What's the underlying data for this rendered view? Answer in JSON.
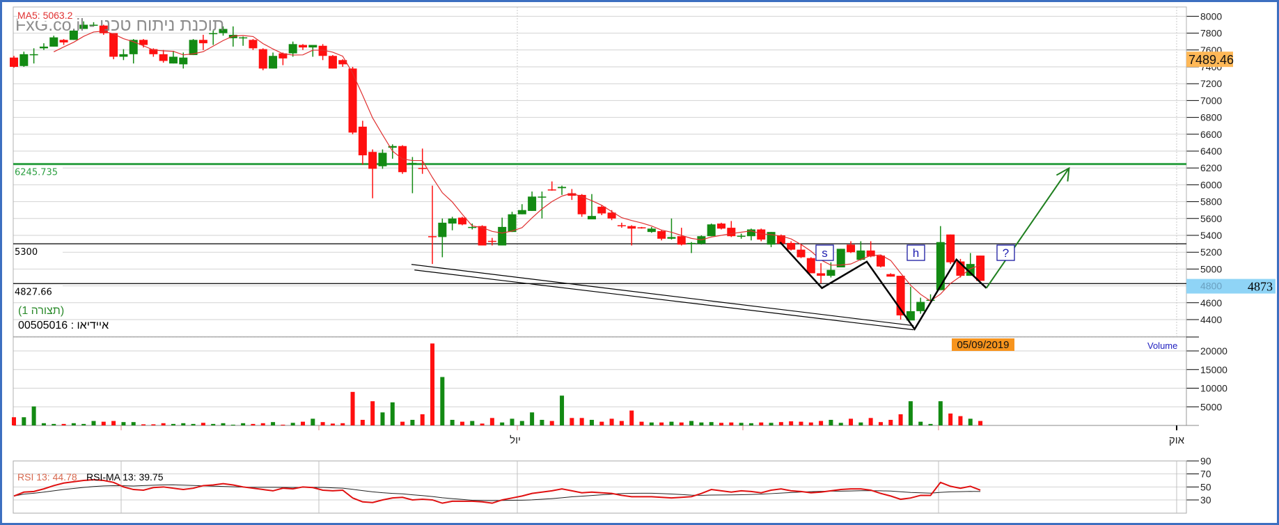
{
  "watermark": "FxG.co.il - תוכנת ניתוח טכני",
  "chart_data": {
    "type": "candlestick",
    "price_axis": {
      "ticks": [
        8000,
        7800,
        7600,
        7400,
        7200,
        7000,
        6800,
        6600,
        6400,
        6200,
        6000,
        5800,
        5600,
        5400,
        5200,
        5000,
        4800,
        4600,
        4400
      ],
      "tick_labels": [
        "8000",
        "7800",
        "7600",
        "7400",
        "7200",
        "7000",
        "6800",
        "6600",
        "6400",
        "6200",
        "6000",
        "5800",
        "5600",
        "5400",
        "5200",
        "5000",
        "4800",
        "4600",
        "4400"
      ],
      "ylim": [
        4200,
        8100
      ],
      "grid": true
    },
    "x_axis": {
      "tick_labels": [
        "יול",
        "אוק"
      ]
    },
    "ma": {
      "label": "MA5:  5063.2",
      "period": 5,
      "color": "#e03030"
    },
    "up_color": "#138a13",
    "down_color": "#ff1010",
    "ohlc": [
      [
        7510,
        7530,
        7390,
        7400
      ],
      [
        7410,
        7580,
        7400,
        7550
      ],
      [
        7550,
        7620,
        7440,
        7550
      ],
      [
        7620,
        7680,
        7600,
        7640
      ],
      [
        7640,
        7770,
        7640,
        7750
      ],
      [
        7720,
        7730,
        7660,
        7690
      ],
      [
        7720,
        7850,
        7720,
        7830
      ],
      [
        7850,
        7940,
        7850,
        7900
      ],
      [
        7900,
        7930,
        7880,
        7900
      ],
      [
        7890,
        7900,
        7780,
        7800
      ],
      [
        7800,
        7800,
        7490,
        7520
      ],
      [
        7520,
        7610,
        7480,
        7550
      ],
      [
        7550,
        7730,
        7440,
        7720
      ],
      [
        7720,
        7730,
        7630,
        7660
      ],
      [
        7610,
        7620,
        7520,
        7550
      ],
      [
        7550,
        7600,
        7450,
        7470
      ],
      [
        7440,
        7590,
        7440,
        7520
      ],
      [
        7430,
        7570,
        7380,
        7510
      ],
      [
        7540,
        7730,
        7540,
        7720
      ],
      [
        7720,
        7780,
        7600,
        7680
      ],
      [
        7800,
        7830,
        7660,
        7800
      ],
      [
        7800,
        7880,
        7770,
        7850
      ],
      [
        7740,
        7880,
        7640,
        7780
      ],
      [
        7750,
        7760,
        7650,
        7750
      ],
      [
        7720,
        7730,
        7600,
        7620
      ],
      [
        7610,
        7620,
        7360,
        7380
      ],
      [
        7380,
        7570,
        7380,
        7530
      ],
      [
        7560,
        7570,
        7420,
        7500
      ],
      [
        7560,
        7700,
        7520,
        7670
      ],
      [
        7660,
        7670,
        7600,
        7630
      ],
      [
        7630,
        7640,
        7520,
        7660
      ],
      [
        7650,
        7670,
        7480,
        7530
      ],
      [
        7530,
        7540,
        7380,
        7380
      ],
      [
        7480,
        7490,
        7400,
        7430
      ],
      [
        7380,
        7400,
        6600,
        6620
      ],
      [
        6690,
        6760,
        6240,
        6350
      ],
      [
        6390,
        6420,
        5840,
        6190
      ],
      [
        6220,
        6420,
        6190,
        6380
      ],
      [
        6440,
        6480,
        6310,
        6460
      ],
      [
        6460,
        6470,
        6130,
        6150
      ],
      [
        6250,
        6330,
        5900,
        6260
      ],
      [
        6200,
        6430,
        6130,
        6190
      ],
      [
        5390,
        5990,
        5060,
        5380
      ],
      [
        5380,
        5600,
        5140,
        5550
      ],
      [
        5540,
        5620,
        5460,
        5600
      ],
      [
        5610,
        5620,
        5520,
        5530
      ],
      [
        5490,
        5540,
        5470,
        5500
      ],
      [
        5510,
        5520,
        5280,
        5280
      ],
      [
        5335,
        5370,
        5280,
        5325
      ],
      [
        5280,
        5610,
        5280,
        5500
      ],
      [
        5440,
        5680,
        5440,
        5650
      ],
      [
        5650,
        5770,
        5650,
        5700
      ],
      [
        5690,
        5920,
        5690,
        5860
      ],
      [
        5850,
        5920,
        5600,
        5860
      ],
      [
        5945,
        6040,
        5930,
        5935
      ],
      [
        5960,
        5990,
        5880,
        5975
      ],
      [
        5900,
        5950,
        5820,
        5870
      ],
      [
        5880,
        5890,
        5620,
        5650
      ],
      [
        5590,
        5890,
        5590,
        5630
      ],
      [
        5740,
        5760,
        5640,
        5660
      ],
      [
        5670,
        5700,
        5580,
        5600
      ],
      [
        5520,
        5550,
        5490,
        5510
      ],
      [
        5510,
        5520,
        5280,
        5480
      ],
      [
        5495,
        5500,
        5480,
        5485
      ],
      [
        5440,
        5500,
        5430,
        5480
      ],
      [
        5450,
        5460,
        5340,
        5360
      ],
      [
        5360,
        5600,
        5350,
        5380
      ],
      [
        5390,
        5490,
        5280,
        5290
      ],
      [
        5305,
        5320,
        5190,
        5310
      ],
      [
        5300,
        5400,
        5290,
        5390
      ],
      [
        5390,
        5540,
        5390,
        5530
      ],
      [
        5540,
        5550,
        5470,
        5480
      ],
      [
        5490,
        5570,
        5380,
        5390
      ],
      [
        5390,
        5420,
        5360,
        5395
      ],
      [
        5390,
        5480,
        5340,
        5470
      ],
      [
        5470,
        5480,
        5330,
        5350
      ],
      [
        5290,
        5440,
        5260,
        5440
      ],
      [
        5400,
        5410,
        5290,
        5300
      ],
      [
        5310,
        5330,
        5220,
        5230
      ],
      [
        5230,
        5290,
        5130,
        5140
      ],
      [
        5130,
        5140,
        4950,
        4950
      ],
      [
        4950,
        5070,
        4830,
        4920
      ],
      [
        4920,
        5080,
        4900,
        4990
      ],
      [
        5020,
        5240,
        5020,
        5240
      ],
      [
        5290,
        5330,
        5190,
        5200
      ],
      [
        5110,
        5330,
        5100,
        5220
      ],
      [
        5220,
        5330,
        5140,
        5150
      ],
      [
        5160,
        5170,
        5020,
        5030
      ],
      [
        4940,
        4950,
        4910,
        4910
      ],
      [
        4920,
        4920,
        4400,
        4450
      ],
      [
        4390,
        4790,
        4390,
        4500
      ],
      [
        4500,
        4660,
        4470,
        4610
      ],
      [
        4625,
        4700,
        4620,
        4635
      ],
      [
        4750,
        5510,
        4750,
        5320
      ],
      [
        5410,
        5410,
        5060,
        5080
      ],
      [
        5090,
        5120,
        4900,
        4920
      ],
      [
        4920,
        5190,
        4920,
        5060
      ],
      [
        5160,
        5160,
        4860,
        4860
      ]
    ],
    "levels": [
      {
        "value": 6245.735,
        "label": "6245.735",
        "color": "#2ea043"
      },
      {
        "value": 5300,
        "label": "5300",
        "color": "#000000"
      },
      {
        "value": 4827.66,
        "label": "4827.66",
        "color": "#000000"
      }
    ],
    "pattern_labels": [
      "s",
      "h",
      "?"
    ],
    "last_price_tag": "7489.46",
    "cursor_price_tag": "4873",
    "cursor_axis_value": "4800",
    "cursor_date_tag": "05/09/2019",
    "volume": {
      "label": "Volume",
      "ticks": [
        20000,
        15000,
        10000,
        5000
      ],
      "tick_labels": [
        "20000",
        "15000",
        "10000",
        "5000"
      ],
      "values": [
        2200,
        2200,
        5100,
        600,
        400,
        400,
        600,
        400,
        1200,
        1000,
        1200,
        900,
        900,
        300,
        300,
        600,
        400,
        600,
        400,
        700,
        400,
        600,
        200,
        600,
        400,
        600,
        900,
        200,
        700,
        1000,
        1800,
        900,
        500,
        600,
        9000,
        1500,
        6500,
        3500,
        6200,
        1000,
        1500,
        3000,
        22000,
        13000,
        1500,
        1000,
        1200,
        500,
        2000,
        800,
        1800,
        1200,
        3500,
        1500,
        1200,
        8000,
        2000,
        2000,
        1500,
        1000,
        1800,
        1200,
        4000,
        1000,
        800,
        800,
        1000,
        800,
        1200,
        800,
        900,
        700,
        800,
        700,
        600,
        800,
        700,
        900,
        1100,
        1000,
        800,
        1200,
        1500,
        700,
        1800,
        800,
        2000,
        900,
        1500,
        3000,
        6500,
        1000,
        400,
        6500,
        3200,
        2500,
        1800,
        1200
      ]
    },
    "rsi": {
      "label": "RSI 13:  44.78",
      "ma_label": "RSI-MA 13:  39.75",
      "period": 13,
      "ma_period": 13,
      "color": "#e01010",
      "label_color": "#d86a50",
      "ticks": [
        90,
        70,
        50,
        30
      ],
      "tick_labels": [
        "90",
        "70",
        "50",
        "30"
      ],
      "values": [
        36,
        42,
        43,
        47,
        52,
        56,
        58,
        60,
        61,
        60,
        57,
        50,
        46,
        45,
        49,
        50,
        48,
        46,
        48,
        52,
        53,
        55,
        53,
        50,
        48,
        46,
        44,
        48,
        47,
        50,
        49,
        45,
        44,
        45,
        33,
        27,
        26,
        30,
        33,
        34,
        30,
        31,
        30,
        25,
        28,
        28,
        28,
        27,
        25,
        30,
        33,
        36,
        40,
        42,
        44,
        47,
        44,
        41,
        42,
        41,
        40,
        37,
        35,
        35,
        35,
        34,
        33,
        34,
        35,
        40,
        46,
        44,
        42,
        44,
        43,
        41,
        45,
        47,
        44,
        43,
        41,
        42,
        44,
        46,
        47,
        47,
        45,
        40,
        36,
        31,
        33,
        37,
        37,
        57,
        51,
        48,
        51,
        45
      ]
    }
  },
  "legend": {
    "config": "(תצורה 1)",
    "id_line": "איידיאו : 00505016"
  }
}
